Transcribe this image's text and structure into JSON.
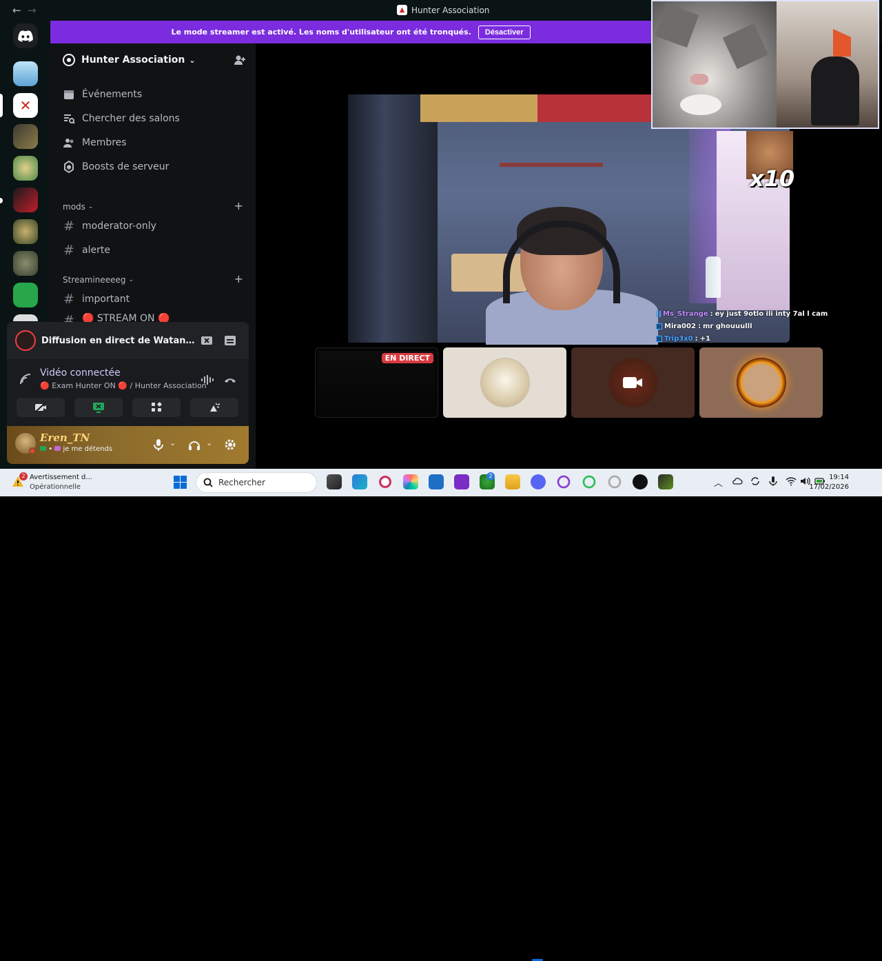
{
  "window": {
    "title": "Hunter Association",
    "back_glyph": "←",
    "forward_glyph": "→"
  },
  "banner": {
    "text": "Le mode streamer est activé. Les noms d'utilisateur ont été tronqués.",
    "button": "Désactiver",
    "color": "#7b2cdf"
  },
  "sidebar": {
    "guild_name": "Hunter Association",
    "menu": [
      {
        "label": "Événements",
        "icon": "calendar-icon"
      },
      {
        "label": "Chercher des salons",
        "icon": "channel-search-icon"
      },
      {
        "label": "Membres",
        "icon": "members-icon"
      },
      {
        "label": "Boosts de serveur",
        "icon": "boost-icon"
      }
    ],
    "categories": [
      {
        "name": "mods",
        "channels": [
          "moderator-only",
          "alerte"
        ]
      },
      {
        "name": "Streamineeeeg",
        "channels": [
          "important",
          "🔴 STREAM ON 🔴"
        ]
      }
    ]
  },
  "stream_panel": {
    "live_title": "Diffusion en direct de Watania Re...",
    "voice_status": "Vidéo connectée",
    "voice_channel": "🔴 Exam Hunter ON 🔴 / Hunter Association"
  },
  "user": {
    "name": "Eren_TN",
    "status": "je me détends",
    "status_sep": "•"
  },
  "stage": {
    "overlay_text": "x10",
    "live_badge": "EN DIRECT",
    "chat": [
      {
        "user": "Ms_Strange",
        "sep": ":",
        "msg": "ey just 9otlo ili inty 7al l cam",
        "color": "#c48bff"
      },
      {
        "user": "Mira002",
        "sep": ":",
        "msg": "mr ghouuulll",
        "color": "#ffffff"
      },
      {
        "user": "Trip3x0",
        "sep": ":",
        "msg": "+1",
        "color": "#4aa3ff"
      }
    ]
  },
  "taskbar": {
    "weather_title": "Avertissement d...",
    "weather_sub": "Opérationnelle",
    "weather_badge": "2",
    "search_placeholder": "Rechercher",
    "xbox_badge": "2",
    "time": "19:14",
    "date": "17/02/2026"
  }
}
